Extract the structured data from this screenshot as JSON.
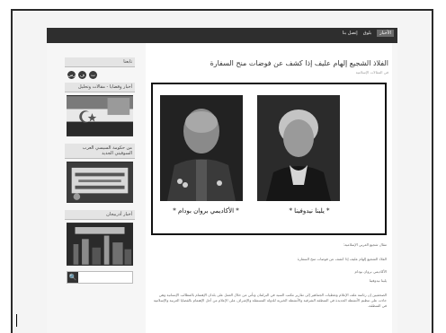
{
  "nav": {
    "items": [
      "الأخبار",
      "بلوق",
      "إتصل بنا"
    ]
  },
  "post": {
    "title": "الفلاذ الشجيع إلهام عليف إذا كشف عن فوضات منح السفارة",
    "meta": "في المقالات الإسلامية",
    "caption_left": "* الأكاديمي بروان بودام *",
    "caption_right": "* يلينا نيدوفينا *",
    "intro_link": "مقال شجيع العربي الإسلامية:",
    "line1": "الفلاذ الشجيع إلهام عليف إذا كشف عن فوضات منح السفارة",
    "line2": "الأكاديمي بروان بودام",
    "line3": "يلينا نيدوفينا",
    "paragraph": "الصحفيين إن رئاسة ملف الإعلام وتغطيات الجماهير إلى تقارير مكتب السيد في البرلمان وتأتي من خلال العمل على بلدان الإهتمام بالمطالب الإنسانية وهي جاءت على تنظيم الأنشطة الجديدة في المنطقة الشرقية والأنشطة الخيرية للدولة المستقلة والإشراف على الإعلام من أجل الإهتمام بالقضايا العربية والإسلامية في المنطقة."
  },
  "sidebar": {
    "social_title": "تابعنا",
    "social_icons": [
      "رس",
      "ف",
      "ت"
    ],
    "widget1_title": "أخبار وقضايا - مقالات وتحليل",
    "widget2_title": "من حكومة السيسي العرب السوفيتي الجديد",
    "widget3_title": "أخبار أذربيجان",
    "search_icon": "🔍"
  }
}
